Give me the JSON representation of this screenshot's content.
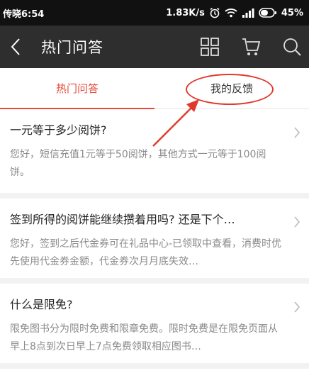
{
  "status": {
    "carrier": "传晓6:54",
    "speed": "1.83K/s",
    "battery": "45%"
  },
  "header": {
    "title": "热门问答",
    "icons": [
      "grid-icon",
      "cart-icon",
      "search-icon"
    ]
  },
  "tabs": [
    {
      "label": "热门问答"
    },
    {
      "label": "我的反馈"
    }
  ],
  "items": [
    {
      "question": "一元等于多少阅饼?",
      "answer": "您好，短信充值1元等于50阅饼，其他方式一元等于100阅饼。"
    },
    {
      "question": "签到所得的阅饼能继续攒着用吗? 还是下个…",
      "answer": "您好，签到之后代金券可在礼品中心-已领取中查看，消费时优先使用代金券金额，代金券次月月底失效…"
    },
    {
      "question": "什么是限免?",
      "answer": "限免图书分为限时免费和限章免费。限时免费是在限免页面从早上8点到次日早上7点免费领取相应图书…"
    }
  ],
  "colors": {
    "accent": "#e54b3c",
    "annotation": "#e03a2e",
    "header_bg": "#2e2e2e"
  }
}
